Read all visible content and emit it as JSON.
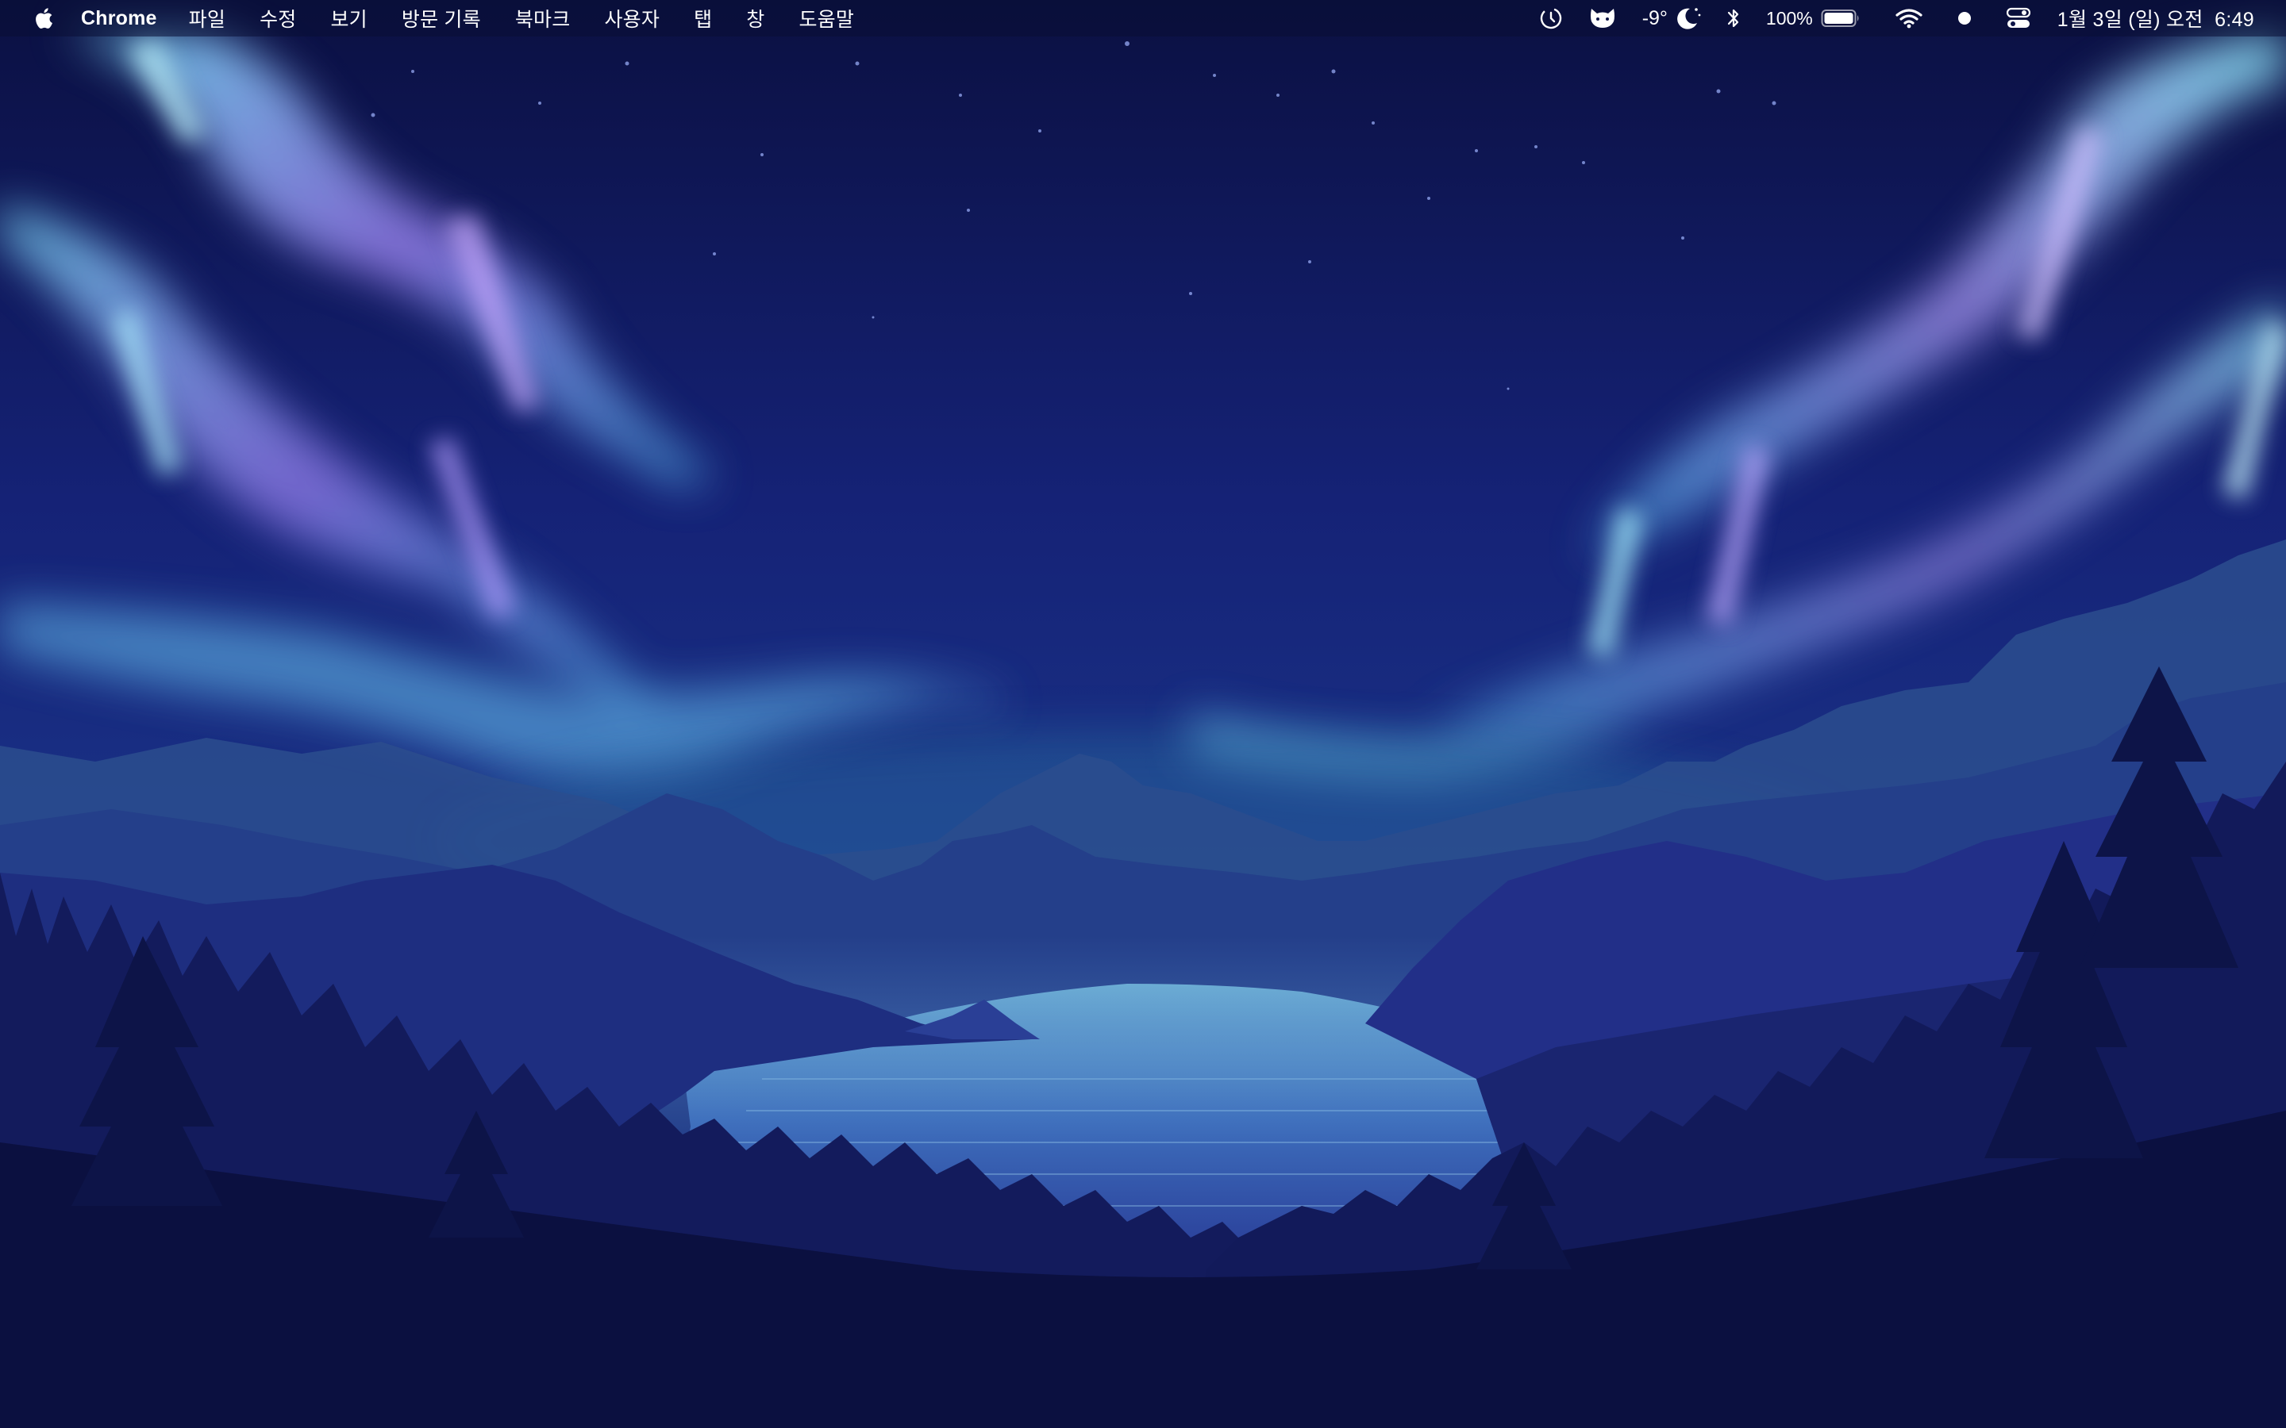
{
  "menubar": {
    "app_name": "Chrome",
    "menus": [
      "파일",
      "수정",
      "보기",
      "방문 기록",
      "북마크",
      "사용자",
      "탭",
      "창",
      "도움말"
    ],
    "status": {
      "weather_temp": "-9°",
      "battery_percent": "100%",
      "clock": "1월 3일 (일) 오전  6:49"
    },
    "icons": [
      "apple-icon",
      "screen-time-icon",
      "cat-icon",
      "moon-icon",
      "bluetooth-icon",
      "battery-icon",
      "wifi-icon",
      "record-dot-icon",
      "control-center-icon"
    ]
  },
  "wallpaper": {
    "description_colors": {
      "sky_top": "#0c1245",
      "sky_mid": "#162a80",
      "aurora_cyan": "#7fe6ff",
      "aurora_violet": "#b39cff",
      "mountain_far": "#2f4f96",
      "mountain_mid": "#24348a",
      "lake": "#3d6cb8",
      "forest": "#0a0e38"
    }
  }
}
